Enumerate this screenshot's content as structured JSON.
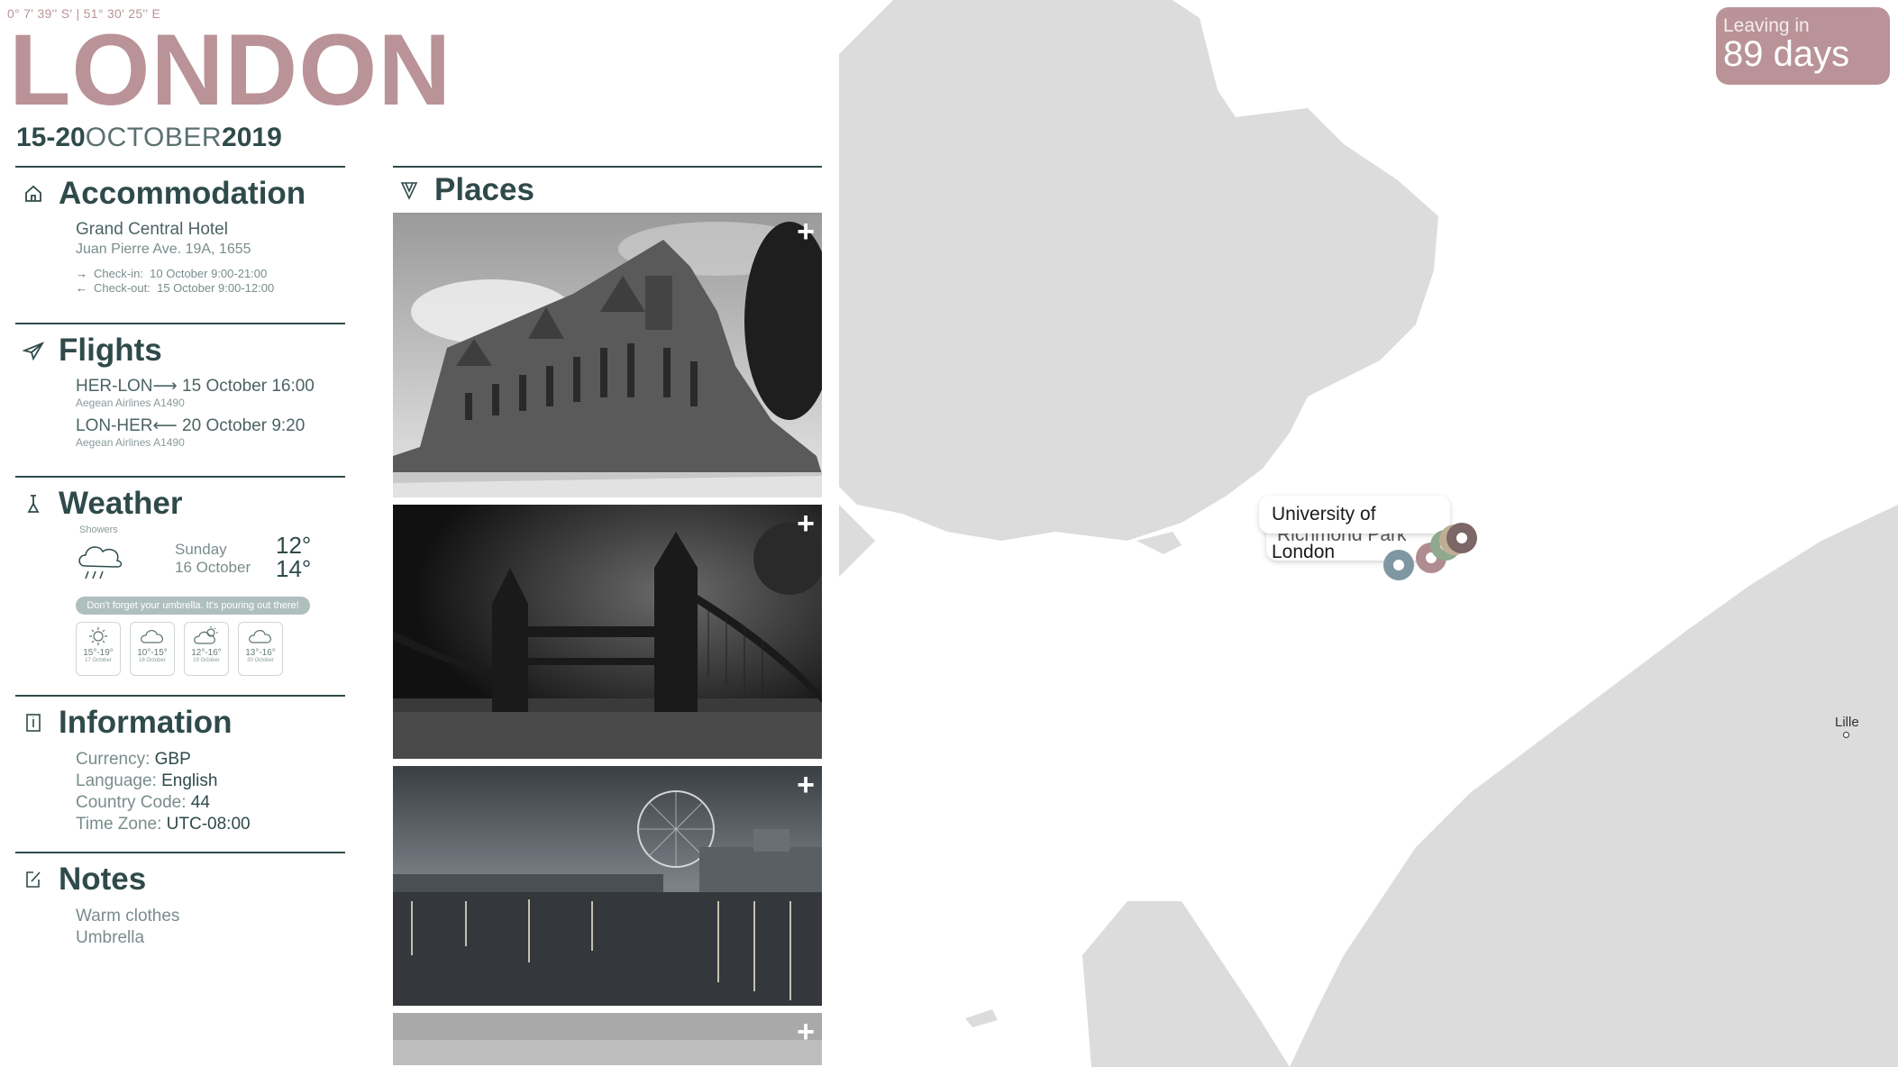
{
  "header": {
    "coords": "0° 7' 39'' S' | 51° 30' 25'' E",
    "city": "LONDON",
    "dates_range": "15-20",
    "dates_month": "OCTOBER",
    "dates_year": "2019"
  },
  "accommodation": {
    "title": "Accommodation",
    "hotel": "Grand Central Hotel",
    "address": "Juan Pierre Ave. 19A, 1655",
    "checkin_label": "Check-in:",
    "checkin_value": "10 October 9:00-21:00",
    "checkout_label": "Check-out:",
    "checkout_value": "15 October 9:00-12:00"
  },
  "flights": {
    "title": "Flights",
    "items": [
      {
        "route": "HER-LON",
        "when": "15 October 16:00",
        "airline": "Aegean Airlines A1490"
      },
      {
        "route": "LON-HER",
        "when": "20 October 9:20",
        "airline": "Aegean Airlines A1490"
      }
    ]
  },
  "weather": {
    "title": "Weather",
    "condition": "Showers",
    "day": "Sunday",
    "date": "16 October",
    "temp_low": "12°",
    "temp_high": "14°",
    "banner": "Don't forget your umbrella. It's pouring out there!",
    "forecast": [
      {
        "icon": "sun-icon",
        "temp": "15°-19°",
        "date": "17 October"
      },
      {
        "icon": "cloud-icon",
        "temp": "10°-15°",
        "date": "18 October"
      },
      {
        "icon": "partly-cloudy-icon",
        "temp": "12°-16°",
        "date": "19 October"
      },
      {
        "icon": "cloud-icon",
        "temp": "13°-16°",
        "date": "20 October"
      }
    ]
  },
  "information": {
    "title": "Information",
    "rows": [
      {
        "label": "Currency:",
        "value": "GBP"
      },
      {
        "label": "Language:",
        "value": "English"
      },
      {
        "label": "Country Code:",
        "value": "44"
      },
      {
        "label": "Time Zone:",
        "value": "UTC-08:00"
      }
    ]
  },
  "notes": {
    "title": "Notes",
    "items": [
      "Warm clothes",
      "Umbrella"
    ]
  },
  "places": {
    "title": "Places",
    "add_label": "+"
  },
  "map": {
    "leaving_label": "Leaving in",
    "leaving_value": "89 days",
    "tooltip_primary": "University of London",
    "tooltip_secondary": "Richmond Park",
    "city_label": "Lille"
  },
  "colors": {
    "accent": "#b99397",
    "text_dark": "#2f4a4a",
    "land": "#dcdcdc",
    "pin_blue": "#7e97a3",
    "pin_rose": "#b08b90",
    "pin_green": "#8fa88f",
    "pin_beige": "#bfae94",
    "pin_brown": "#7c6666"
  }
}
